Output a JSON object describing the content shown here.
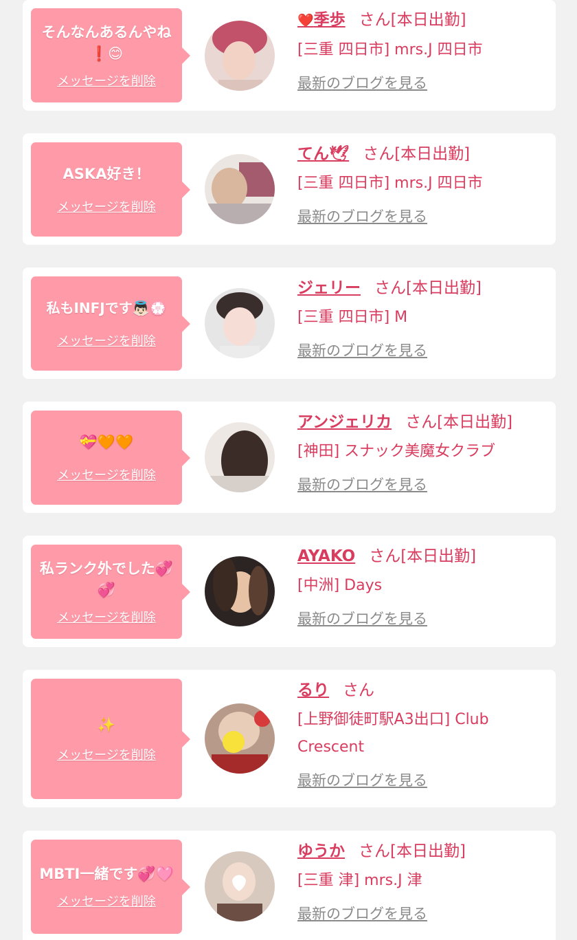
{
  "colors": {
    "background": "#f1f1f1",
    "card": "#ffffff",
    "bubble": "#ff9aa8",
    "accent": "#d83c5e",
    "muted": "#8a8a8a"
  },
  "items": [
    {
      "message": "そんなんあるんやね❗😊",
      "delete_label": "メッセージを削除",
      "name_prefix_icon": "❤️",
      "name": "季歩",
      "suffix": "さん[本日出勤]",
      "shop": "[三重 四日市] mrs.J 四日市",
      "blog_label": "最新のブログを見る"
    },
    {
      "message": "ASKA好き！",
      "delete_label": "メッセージを削除",
      "name": "てん🕊",
      "suffix": "さん[本日出勤]",
      "shop": "[三重 四日市] mrs.J 四日市",
      "blog_label": "最新のブログを見る"
    },
    {
      "message": "私もINFJです👼🏻💮",
      "delete_label": "メッセージを削除",
      "name": "ジェリー",
      "suffix": "さん[本日出勤]",
      "shop": "[三重 四日市] M",
      "blog_label": "最新のブログを見る"
    },
    {
      "message": "💝🧡🧡",
      "delete_label": "メッセージを削除",
      "name": "アンジェリカ",
      "suffix": "さん[本日出勤]",
      "shop": "[神田] スナック美魔女クラブ",
      "blog_label": "最新のブログを見る"
    },
    {
      "message": "私ランク外でした💞💞",
      "delete_label": "メッセージを削除",
      "name": "AYAKO",
      "suffix": "さん[本日出勤]",
      "shop": "[中洲] Days",
      "blog_label": "最新のブログを見る"
    },
    {
      "message": "✨",
      "delete_label": "メッセージを削除",
      "name": "るり",
      "suffix": "さん",
      "shop": "[上野御徒町駅A3出口] Club Crescent",
      "blog_label": "最新のブログを見る"
    },
    {
      "message": "MBTI一緒です💞🩷",
      "delete_label": "メッセージを削除",
      "name": "ゆうか",
      "suffix": "さん[本日出勤]",
      "shop": "[三重 津] mrs.J 津",
      "blog_label": "最新のブログを見る"
    }
  ]
}
